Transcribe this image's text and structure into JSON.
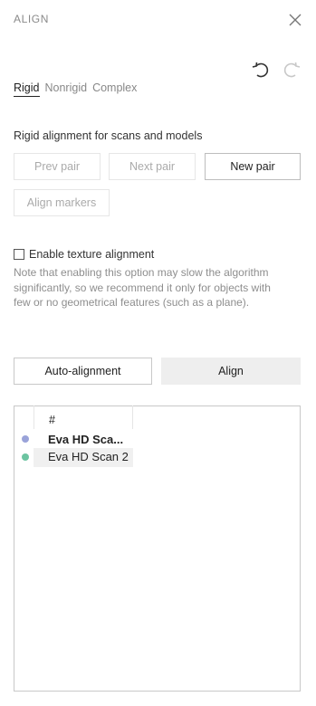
{
  "panel": {
    "title": "ALIGN"
  },
  "icons": {
    "close": "close-icon",
    "undo": "undo-icon",
    "redo": "redo-icon"
  },
  "tabs": [
    {
      "label": "Rigid",
      "active": true
    },
    {
      "label": "Nonrigid",
      "active": false
    },
    {
      "label": "Complex",
      "active": false
    }
  ],
  "rigid": {
    "heading": "Rigid alignment for scans and models",
    "prev_pair": "Prev pair",
    "next_pair": "Next pair",
    "new_pair": "New pair",
    "align_markers": "Align markers"
  },
  "texture": {
    "checkbox_label": "Enable texture alignment",
    "checked": false,
    "note": "Note that enabling this option may slow the algorithm significantly, so we recommend it only for objects with few or no geometrical features (such as a plane)."
  },
  "actions": {
    "auto_alignment": "Auto-alignment",
    "align": "Align"
  },
  "list": {
    "column_header": "#",
    "rows": [
      {
        "label": "Eva HD Sca...",
        "color": "#9aa3d9",
        "bold": true,
        "selected": false
      },
      {
        "label": "Eva HD Scan 2",
        "color": "#6cc4a1",
        "bold": false,
        "selected": true
      }
    ]
  }
}
